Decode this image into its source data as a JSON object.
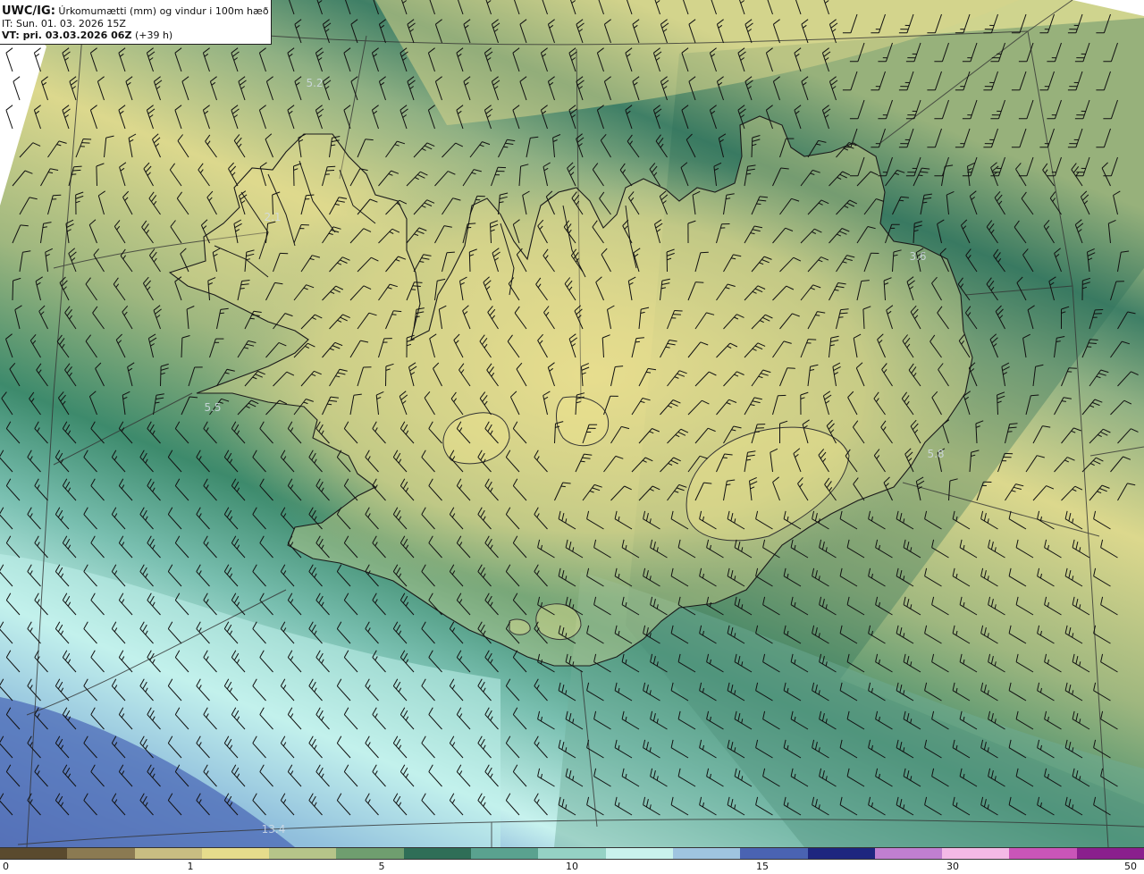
{
  "header": {
    "model": "UWC/IG:",
    "title": "Úrkomumætti (mm) og vindur i 100m hæð",
    "init_time": "IT: Sun. 01. 03. 2026 15Z",
    "valid_label": "VT: pri. 03.03.2026 06Z",
    "valid_offset": "(+39 h)"
  },
  "value_labels": [
    {
      "text": "5.2"
    },
    {
      "text": "2.1"
    },
    {
      "text": "3.6"
    },
    {
      "text": "5.5"
    },
    {
      "text": "5.8"
    },
    {
      "text": "13.4"
    }
  ],
  "colorbar": {
    "ticks": [
      "0",
      "1",
      "5",
      "10",
      "15",
      "30",
      "50"
    ],
    "colors": [
      "#5a4a2e",
      "#8b7a52",
      "#c8bd82",
      "#e6dc8c",
      "#b6c489",
      "#6f9e6f",
      "#2f6e57",
      "#5aa28f",
      "#95d2c4",
      "#c9f2ec",
      "#9fc4e0",
      "#4a63b2",
      "#1e267f",
      "#c07fd0",
      "#f4b9e6",
      "#ca55b8",
      "#8a1f8d"
    ]
  },
  "colors": {
    "land_outline": "#1a1a1a",
    "barb": "#111111",
    "grid": "#333333"
  }
}
